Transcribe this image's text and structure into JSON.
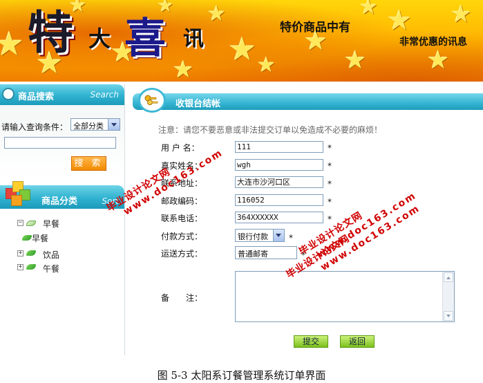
{
  "banner": {
    "big_chars": [
      "特",
      "大",
      "喜",
      "讯"
    ],
    "slogan1": "特价商品中有",
    "slogan2": "非常优惠的讯息"
  },
  "search_panel": {
    "title": "商品搜索",
    "title_en": "Search",
    "condition_label": "请输入查询条件：",
    "category_select": "全部分类",
    "search_input": "",
    "search_button": "搜 索"
  },
  "category_panel": {
    "title": "商品分类",
    "title_en": "Sort",
    "tree": [
      {
        "label": "早餐",
        "expanded": true,
        "children": [
          "早餐"
        ]
      },
      {
        "label": "饮品",
        "expanded": false,
        "children": []
      },
      {
        "label": "午餐",
        "expanded": false,
        "children": []
      }
    ]
  },
  "checkout": {
    "title": "收银台结帐",
    "notice": "注意：请您不要恶意或非法提交订单以免造成不必要的麻烦！",
    "fields": {
      "username": {
        "label": "用 户 名：",
        "value": "111",
        "required": "*"
      },
      "realname": {
        "label": "真实姓名：",
        "value": "wgh",
        "required": "*"
      },
      "address": {
        "label": "联系地址：",
        "value": "大连市沙河口区",
        "required": "*"
      },
      "zipcode": {
        "label": "邮政编码：",
        "value": "116052",
        "required": "*"
      },
      "phone": {
        "label": "联系电话：",
        "value": "364XXXXXX",
        "required": "*"
      },
      "payment": {
        "label": "付款方式：",
        "value": "银行付款",
        "required": "*"
      },
      "shipping": {
        "label": "运送方式：",
        "value": "普通邮寄",
        "required": "*"
      },
      "remarks": {
        "label": "备　　注：",
        "value": ""
      }
    },
    "submit_button": "提交",
    "back_button": "返回"
  },
  "watermarks": [
    {
      "line1": "毕业设计论文网",
      "line2": "www.doc163.com"
    },
    {
      "line1": "毕业设计论文网",
      "line2": "www.doc163.com"
    },
    {
      "line1": "毕业设计论文网",
      "line2": "www.doc163.com"
    }
  ],
  "caption": "图 5-3 太阳系订餐管理系统订单界面",
  "colors": {
    "header_cyan": "#2fb2d0",
    "search_button_orange": "#f28a00",
    "green_button": "#7cc01d",
    "watermark_red": "#d00000"
  }
}
